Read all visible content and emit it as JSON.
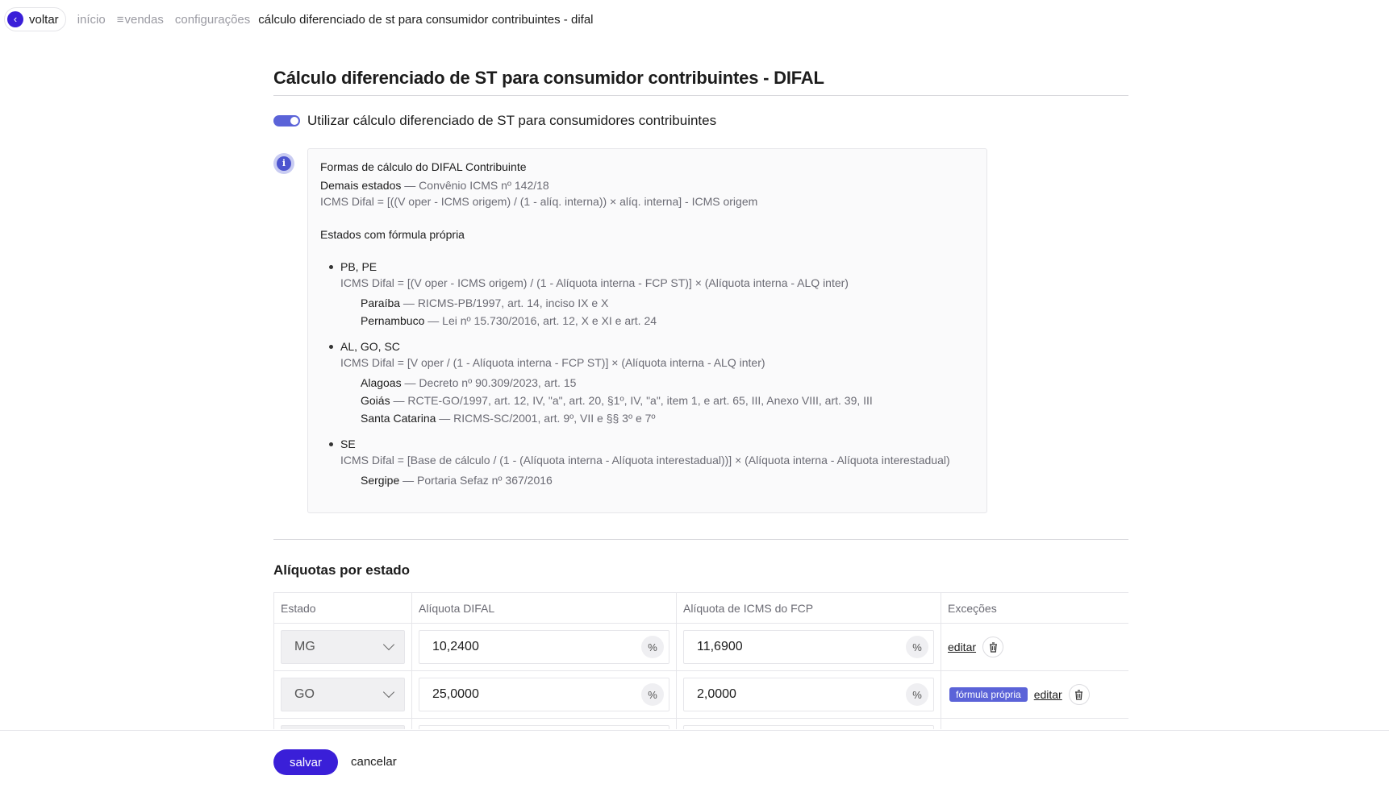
{
  "topbar": {
    "back_label": "voltar",
    "back_icon": "chevron-left-icon",
    "breadcrumbs": [
      "início",
      "vendas",
      "configurações"
    ],
    "current": "cálculo diferenciado de st para consumidor contribuintes - difal"
  },
  "page": {
    "title": "Cálculo diferenciado de ST para consumidor contribuintes - DIFAL",
    "toggle_label": "Utilizar cálculo diferenciado de ST para consumidores contribuintes",
    "toggle_on": true
  },
  "info": {
    "icon": "info-icon",
    "heading": "Formas de cálculo do DIFAL Contribuinte",
    "general_label": "Demais estados",
    "general_ref": " — Convênio ICMS nº 142/18",
    "general_formula": "ICMS Difal = [((V oper - ICMS origem) / (1 - alíq. interna)) × alíq. interna] - ICMS origem",
    "own_formula_heading": "Estados com fórmula própria",
    "groups": [
      {
        "states": "PB, PE",
        "formula": "ICMS Difal = [(V oper - ICMS origem) / (1 - Alíquota interna - FCP ST)] × (Alíquota interna - ALQ inter)",
        "laws": [
          {
            "state": "Paraíba",
            "ref": " — RICMS-PB/1997, art. 14, inciso IX e X"
          },
          {
            "state": "Pernambuco",
            "ref": " — Lei nº 15.730/2016, art. 12, X e XI e art. 24"
          }
        ]
      },
      {
        "states": "AL, GO, SC",
        "formula": "ICMS Difal = [V oper / (1 - Alíquota interna - FCP ST)] × (Alíquota interna - ALQ inter)",
        "laws": [
          {
            "state": "Alagoas",
            "ref": " — Decreto nº 90.309/2023, art. 15"
          },
          {
            "state": "Goiás",
            "ref": " — RCTE-GO/1997, art. 12, IV, \"a\", art. 20, §1º, IV, \"a\", item 1, e art. 65, III, Anexo VIII, art. 39, III"
          },
          {
            "state": "Santa Catarina",
            "ref": " — RICMS-SC/2001, art. 9º, VII e §§ 3º e 7º"
          }
        ]
      },
      {
        "states": "SE",
        "formula": "ICMS Difal = [Base de cálculo / (1 - (Alíquota interna - Alíquota interestadual))] × (Alíquota interna - Alíquota interestadual)",
        "laws": [
          {
            "state": "Sergipe",
            "ref": " — Portaria Sefaz nº 367/2016"
          }
        ]
      }
    ]
  },
  "rates": {
    "section_title": "Alíquotas por estado",
    "columns": [
      "Estado",
      "Alíquota DIFAL",
      "Alíquota de ICMS do FCP",
      "Exceções"
    ],
    "percent_symbol": "%",
    "edit_label": "editar",
    "badge_label": "fórmula própria",
    "rows": [
      {
        "state": "MG",
        "difal": "10,2400",
        "fcp": "11,6900",
        "own_formula": false
      },
      {
        "state": "GO",
        "difal": "25,0000",
        "fcp": "2,0000",
        "own_formula": true
      }
    ]
  },
  "footer": {
    "save_label": "salvar",
    "cancel_label": "cancelar"
  },
  "colors": {
    "primary": "#3a1fd8",
    "accent": "#5b63d8"
  }
}
